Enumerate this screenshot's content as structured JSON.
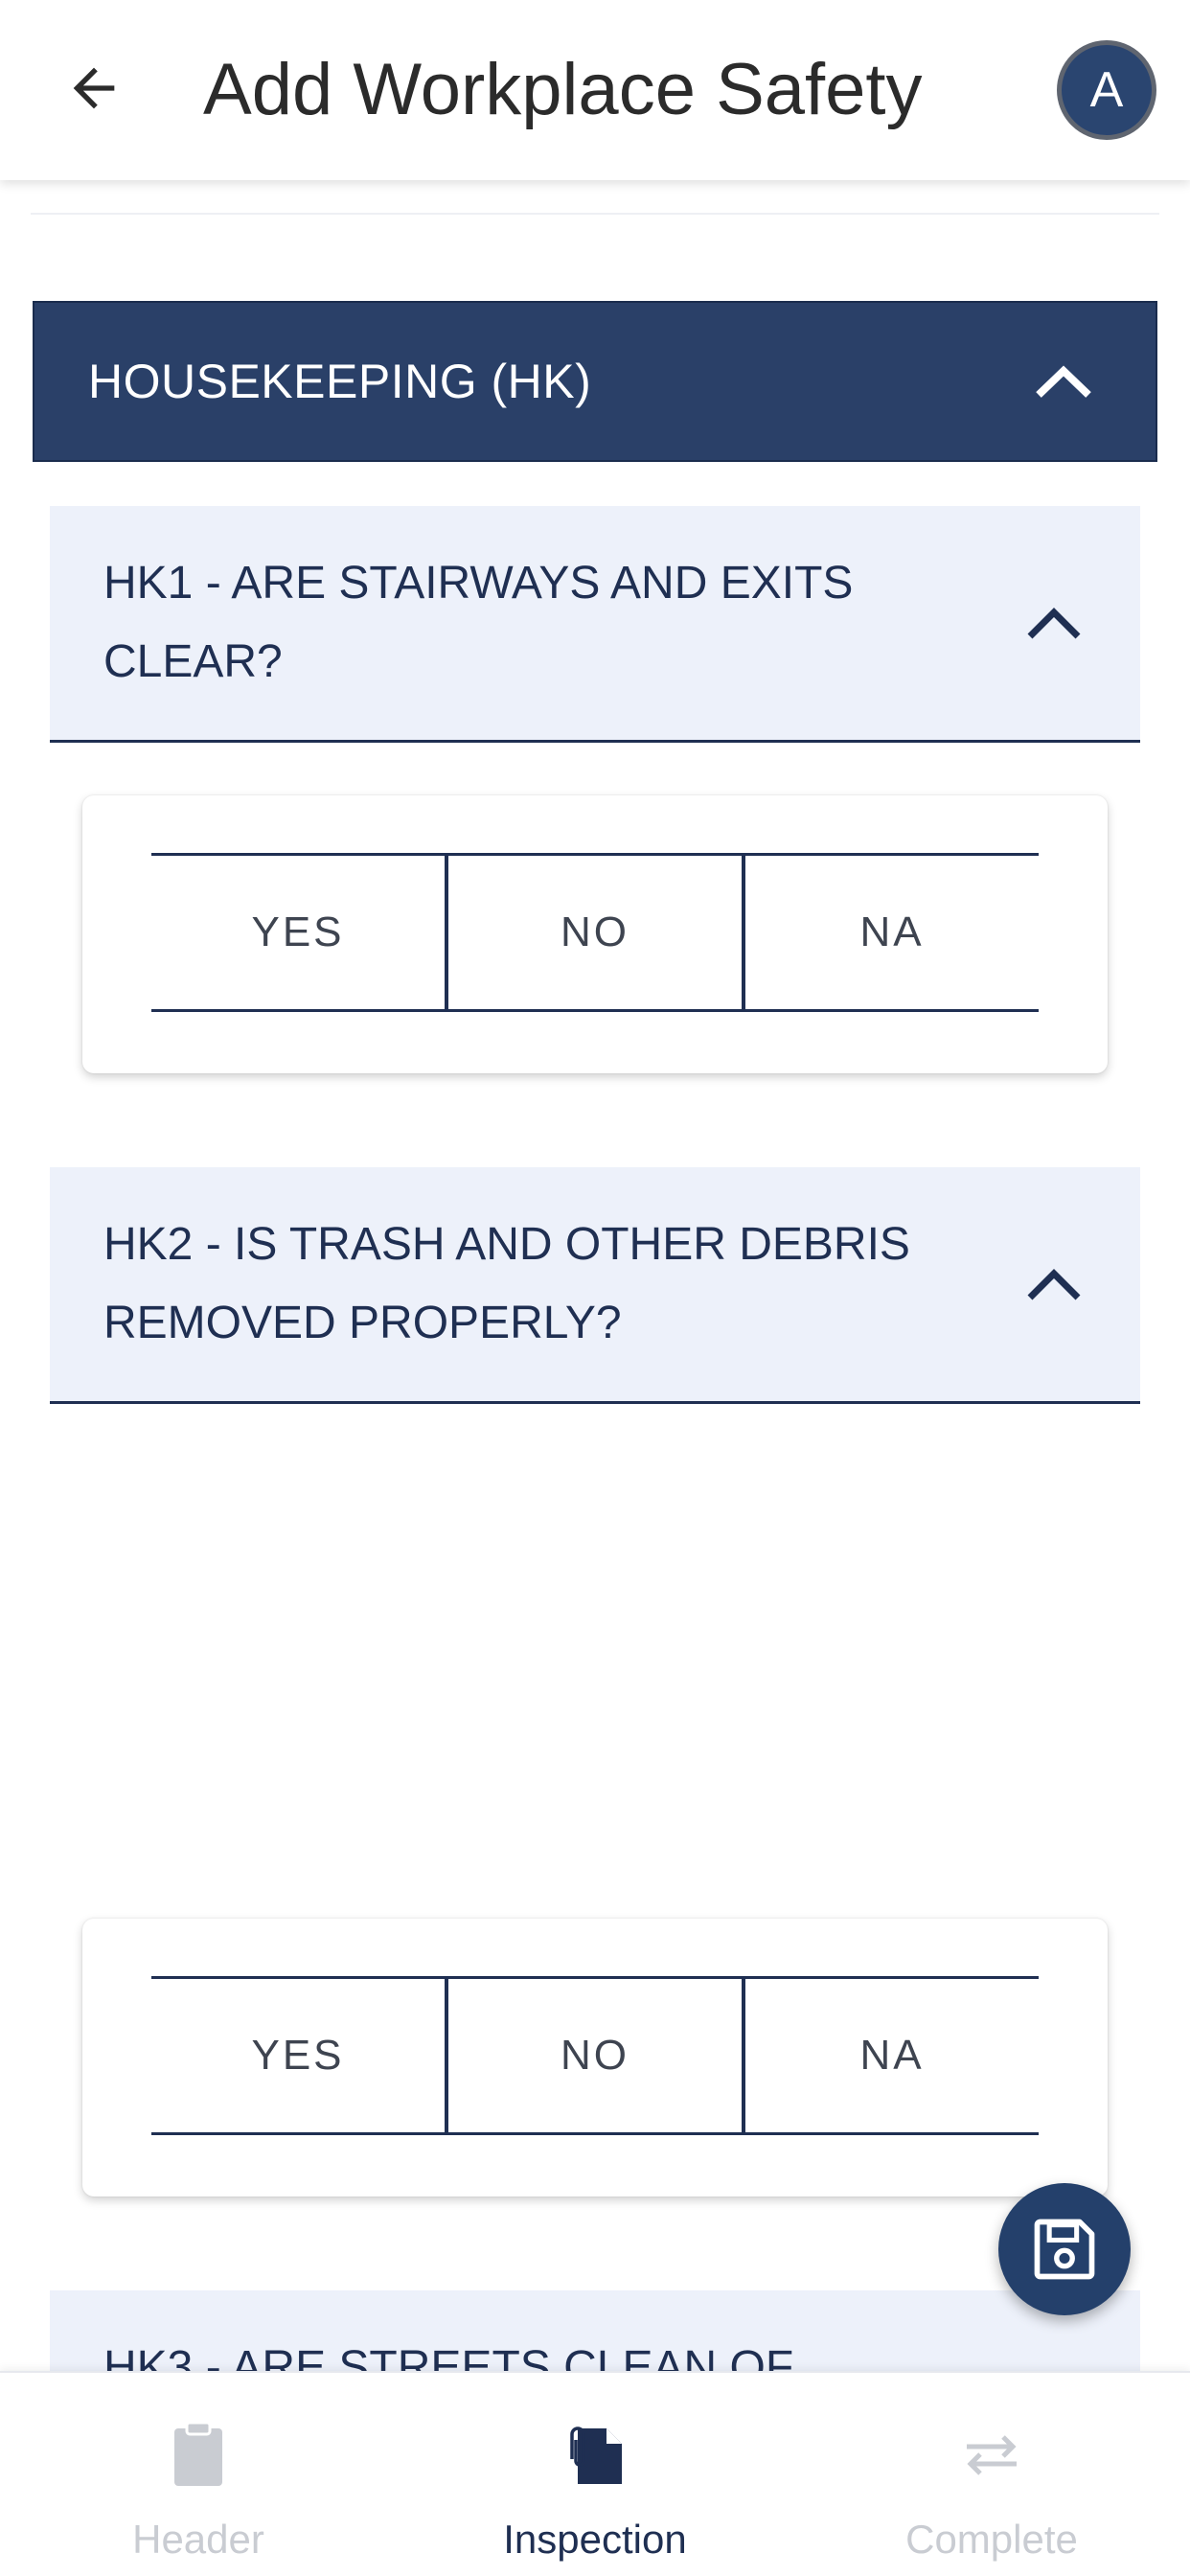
{
  "appbar": {
    "title": "Add Workplace Safety",
    "avatar_initial": "A"
  },
  "section": {
    "title": "HOUSEKEEPING (HK)"
  },
  "questions": [
    {
      "title": "HK1 - ARE STAIRWAYS AND EXITS CLEAR?",
      "options": [
        "YES",
        "NO",
        "NA"
      ]
    },
    {
      "title": "HK2 - IS TRASH AND OTHER DEBRIS REMOVED PROPERLY?",
      "options": [
        "YES",
        "NO",
        "NA"
      ]
    },
    {
      "title": "HK3 - ARE STREETS CLEAN OF"
    }
  ],
  "bottom_nav": {
    "items": [
      {
        "label": "Header",
        "icon": "clipboard-icon",
        "state": "inactive"
      },
      {
        "label": "Inspection",
        "icon": "inspection-icon",
        "state": "active"
      },
      {
        "label": "Complete",
        "icon": "swap-icon",
        "state": "inactive"
      }
    ]
  },
  "colors": {
    "primary": "#2a4068",
    "question_bg": "#edf1fa",
    "active_nav": "#1f2f52",
    "inactive_nav": "#c9ccd2"
  }
}
